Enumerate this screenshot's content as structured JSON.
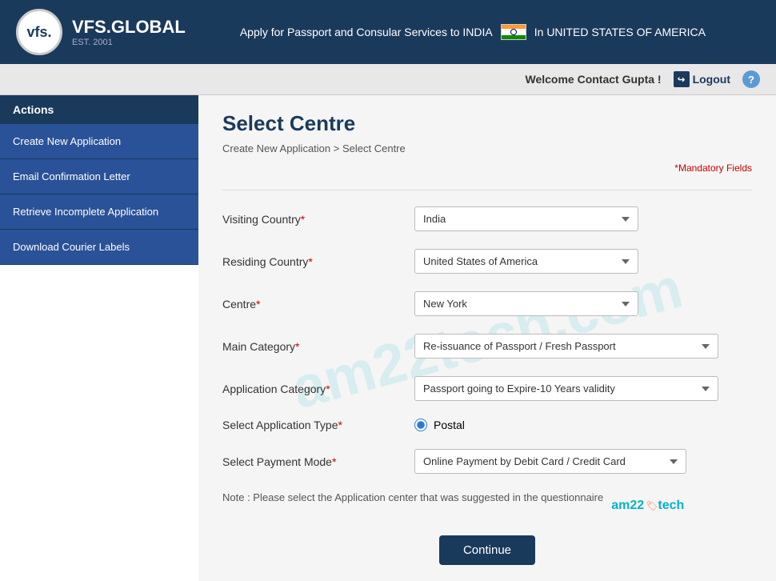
{
  "header": {
    "logo_text": "vfs.",
    "brand_name": "VFS.GLOBAL",
    "est": "EST. 2001",
    "center_text": "Apply for Passport and Consular Services to INDIA",
    "country_text": "In UNITED STATES OF AMERICA"
  },
  "topnav": {
    "welcome_text": "Welcome Contact Gupta !",
    "logout_label": "Logout",
    "help_label": "?"
  },
  "sidebar": {
    "header_label": "Actions",
    "items": [
      {
        "label": "Create New Application"
      },
      {
        "label": "Email Confirmation Letter"
      },
      {
        "label": "Retrieve Incomplete Application"
      },
      {
        "label": "Download Courier Labels"
      }
    ]
  },
  "main": {
    "page_title": "Select Centre",
    "breadcrumb_home": "Create New Application",
    "breadcrumb_sep": ">",
    "breadcrumb_current": "Select Centre",
    "mandatory_note": "*Mandatory Fields",
    "watermark": "am22tech.com",
    "form": {
      "visiting_country_label": "Visiting Country",
      "visiting_country_value": "India",
      "residing_country_label": "Residing Country",
      "residing_country_value": "United States of America",
      "centre_label": "Centre",
      "centre_value": "New York",
      "main_category_label": "Main Category",
      "main_category_value": "Re-issuance of Passport / Fresh Passport",
      "app_category_label": "Application Category",
      "app_category_value": "Passport going to Expire-10 Years validity",
      "app_type_label": "Select Application Type",
      "app_type_value": "Postal",
      "payment_mode_label": "Select Payment Mode",
      "payment_mode_value": "Online Payment by Debit Card / Credit Card"
    },
    "note_text": "Note : Please select the Application center that was suggested in the questionnaire",
    "am22_text": "am22",
    "am22_tag": "🏷",
    "am22_suffix": "tech",
    "continue_label": "Continue"
  }
}
